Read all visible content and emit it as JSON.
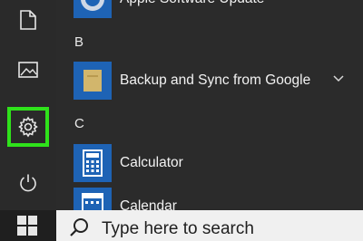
{
  "left_rail": {
    "items": [
      {
        "name": "documents",
        "icon": "document-icon",
        "selected": false
      },
      {
        "name": "pictures",
        "icon": "picture-icon",
        "selected": false
      },
      {
        "name": "settings",
        "icon": "gear-icon",
        "selected": true,
        "highlight_color": "#2fe21b"
      },
      {
        "name": "power",
        "icon": "power-icon",
        "selected": false
      }
    ]
  },
  "app_list": {
    "items": [
      {
        "type": "app",
        "label": "Apple Software Update",
        "icon": "apple-software-update-icon"
      },
      {
        "type": "header",
        "label": "B"
      },
      {
        "type": "app",
        "label": "Backup and Sync from Google",
        "icon": "backup-sync-icon",
        "expandable": true
      },
      {
        "type": "header",
        "label": "C"
      },
      {
        "type": "app",
        "label": "Calculator",
        "icon": "calculator-icon"
      },
      {
        "type": "app",
        "label": "Calendar",
        "icon": "calendar-icon"
      }
    ]
  },
  "taskbar": {
    "start_icon": "windows-logo-icon",
    "search": {
      "icon": "search-icon",
      "placeholder": "Type here to search"
    }
  },
  "colors": {
    "tile_blue": "#1e63b5",
    "highlight": "#2fe21b"
  }
}
